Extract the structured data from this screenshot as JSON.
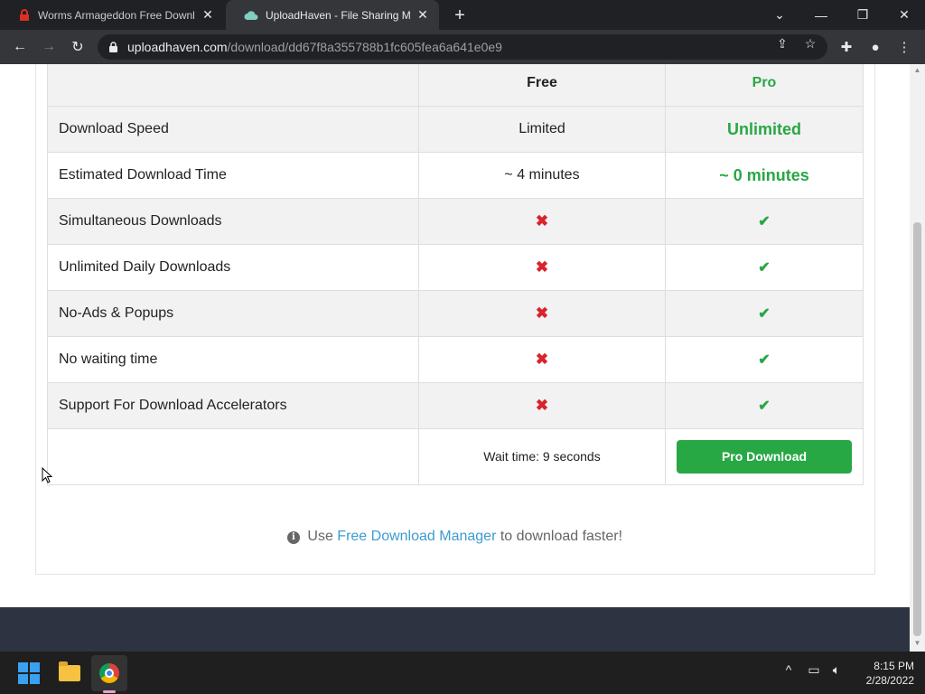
{
  "browser": {
    "tabs": [
      {
        "title": "Worms Armageddon Free Downl",
        "active": false
      },
      {
        "title": "UploadHaven - File Sharing Made",
        "active": true
      }
    ],
    "url_host": "uploadhaven.com",
    "url_path": "/download/dd67f8a355788b1fc605fea6a641e0e9"
  },
  "table": {
    "headers": {
      "free": "Free",
      "pro": "Pro"
    },
    "rows": [
      {
        "feature": "Download Speed",
        "free": "Limited",
        "pro": "Unlimited"
      },
      {
        "feature": "Estimated Download Time",
        "free": "~ 4 minutes",
        "pro": "~ 0 minutes"
      },
      {
        "feature": "Simultaneous Downloads",
        "free": "x-icon",
        "pro": "check-icon"
      },
      {
        "feature": "Unlimited Daily Downloads",
        "free": "x-icon",
        "pro": "check-icon"
      },
      {
        "feature": "No-Ads & Popups",
        "free": "x-icon",
        "pro": "check-icon"
      },
      {
        "feature": "No waiting time",
        "free": "x-icon",
        "pro": "check-icon"
      },
      {
        "feature": "Support For Download Accelerators",
        "free": "x-icon",
        "pro": "check-icon"
      }
    ],
    "wait_text": "Wait time: 9 seconds",
    "pro_download_label": "Pro Download"
  },
  "hint": {
    "prefix": "Use",
    "link": "Free Download Manager",
    "suffix": "to download faster!"
  },
  "taskbar": {
    "time": "8:15 PM",
    "date": "2/28/2022"
  },
  "colors": {
    "pro_green": "#28a745",
    "x_red": "#d9232d",
    "link_blue": "#3d9bd0",
    "footer_bg": "#2d3340"
  }
}
